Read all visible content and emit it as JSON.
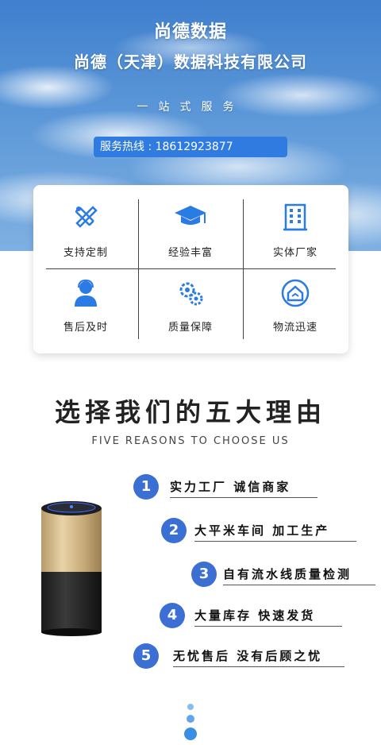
{
  "hero": {
    "title": "尚德数据",
    "company": "尚德（天津）数据科技有限公司",
    "slogan": "一站式服务",
    "hotline": "服务热线 : 18612923877"
  },
  "features": [
    {
      "label": "支持定制",
      "icon": "tools-icon"
    },
    {
      "label": "经验丰富",
      "icon": "graduation-cap-icon"
    },
    {
      "label": "实体厂家",
      "icon": "building-icon"
    },
    {
      "label": "售后及时",
      "icon": "service-person-icon"
    },
    {
      "label": "质量保障",
      "icon": "gears-icon"
    },
    {
      "label": "物流迅速",
      "icon": "home-return-icon"
    }
  ],
  "reasons_section": {
    "title": "选择我们的五大理由",
    "subtitle": "FIVE REASONS TO CHOOSE US"
  },
  "reasons": [
    {
      "num": "1",
      "text": "实力工厂 诚信商家"
    },
    {
      "num": "2",
      "text": "大平米车间 加工生产"
    },
    {
      "num": "3",
      "text": "自有流水线质量检测"
    },
    {
      "num": "4",
      "text": "大量库存 快速发货"
    },
    {
      "num": "5",
      "text": "无忧售后 没有后顾之忧"
    }
  ],
  "colors": {
    "accent": "#3b6fd3",
    "hotline_bg": "#2f7be0",
    "icon_blue": "#2a7be4"
  }
}
